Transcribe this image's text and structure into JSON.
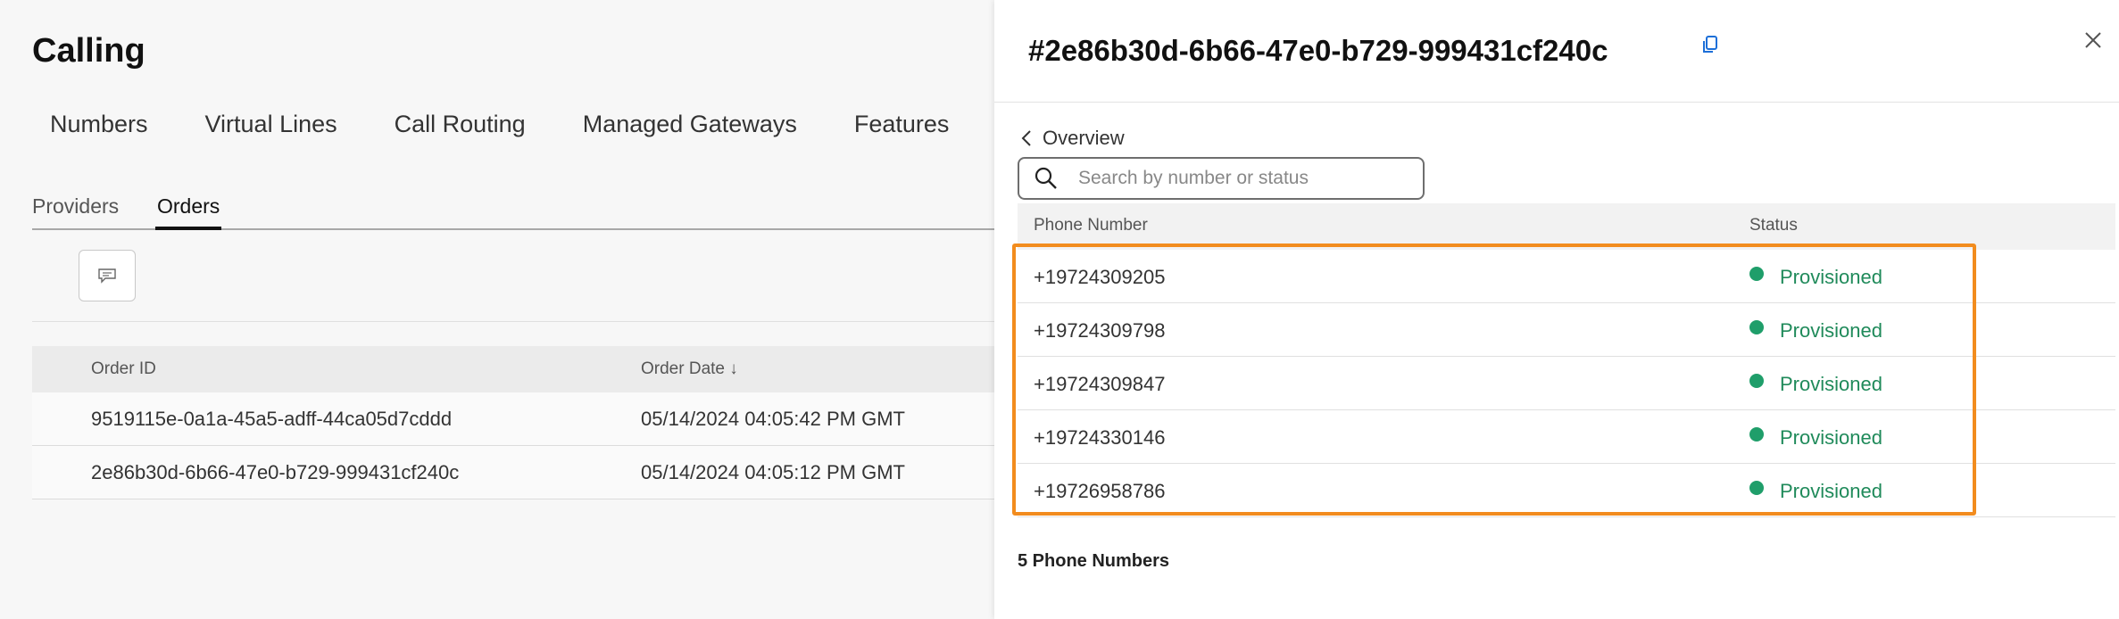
{
  "page": {
    "title": "Calling",
    "nav_tabs": [
      "Numbers",
      "Virtual Lines",
      "Call Routing",
      "Managed Gateways",
      "Features"
    ],
    "sub_tabs": {
      "providers": "Providers",
      "orders": "Orders"
    },
    "orders_table": {
      "columns": {
        "order_id": "Order ID",
        "order_date": "Order Date ↓"
      },
      "rows": [
        {
          "order_id": "9519115e-0a1a-45a5-adff-44ca05d7cddd",
          "order_date": "05/14/2024 04:05:42 PM GMT"
        },
        {
          "order_id": "2e86b30d-6b66-47e0-b729-999431cf240c",
          "order_date": "05/14/2024 04:05:12 PM GMT"
        }
      ]
    }
  },
  "panel": {
    "title": "#2e86b30d-6b66-47e0-b729-999431cf240c",
    "back_label": "Overview",
    "search": {
      "placeholder": "Search by number or status",
      "value": ""
    },
    "table": {
      "columns": {
        "phone": "Phone Number",
        "status": "Status"
      },
      "rows": [
        {
          "phone": "+19724309205",
          "status": "Provisioned"
        },
        {
          "phone": "+19724309798",
          "status": "Provisioned"
        },
        {
          "phone": "+19724309847",
          "status": "Provisioned"
        },
        {
          "phone": "+19724330146",
          "status": "Provisioned"
        },
        {
          "phone": "+19726958786",
          "status": "Provisioned"
        }
      ]
    },
    "count_label": "5 Phone Numbers"
  },
  "colors": {
    "highlight": "#f28c1e",
    "status_green": "#1f9e6a"
  },
  "icons": [
    "feedback-icon",
    "copy-icon",
    "close-icon",
    "chevron-left-icon",
    "search-icon"
  ]
}
